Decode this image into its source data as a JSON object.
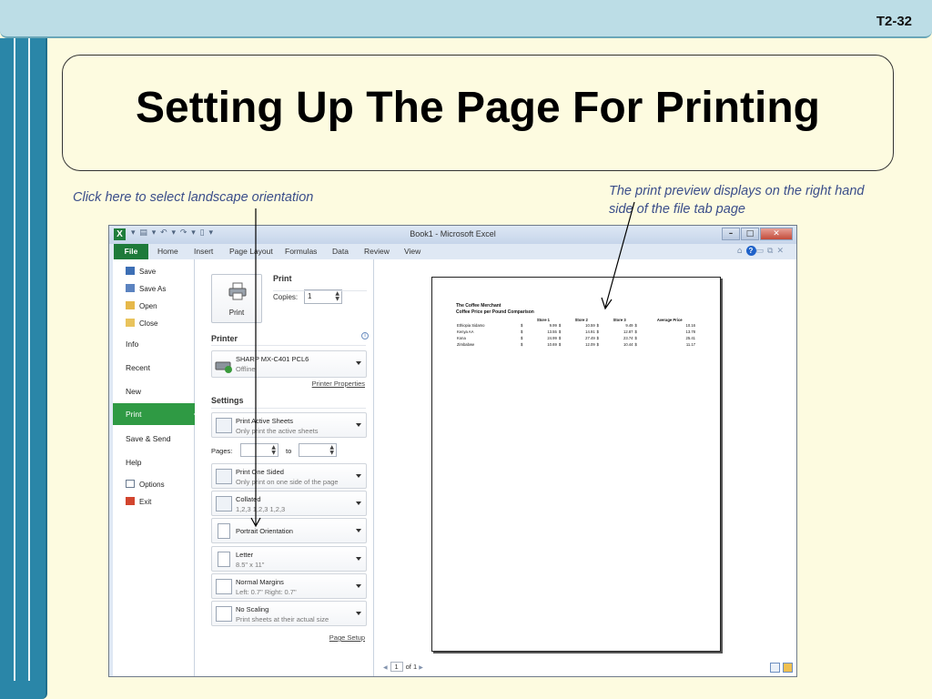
{
  "slide": {
    "number": "T2-32",
    "title": "Setting Up The Page For Printing",
    "annotation_left": "Click here to select landscape orientation",
    "annotation_right": "The print preview displays on the right hand side of the file tab page"
  },
  "window": {
    "title": "Book1 - Microsoft Excel",
    "app_icon": "X",
    "controls": [
      "–",
      "□",
      "✕"
    ]
  },
  "ribbon_tabs": [
    "File",
    "Home",
    "Insert",
    "Page Layout",
    "Formulas",
    "Data",
    "Review",
    "View"
  ],
  "nav": {
    "items": [
      {
        "label": "Save",
        "icon": "save-icon"
      },
      {
        "label": "Save As",
        "icon": "save-as-icon"
      },
      {
        "label": "Open",
        "icon": "open-folder-icon"
      },
      {
        "label": "Close",
        "icon": "close-folder-icon"
      },
      {
        "label": "Info"
      },
      {
        "label": "Recent"
      },
      {
        "label": "New"
      },
      {
        "label": "Print",
        "selected": true
      },
      {
        "label": "Save & Send"
      },
      {
        "label": "Help"
      },
      {
        "label": "Options",
        "icon": "options-icon"
      },
      {
        "label": "Exit",
        "icon": "exit-icon"
      }
    ]
  },
  "print": {
    "button_label": "Print",
    "heading": "Print",
    "copies_label": "Copies:",
    "copies_value": "1"
  },
  "printer": {
    "heading": "Printer",
    "info_icon": "i",
    "name": "SHARP MX-C401 PCL6",
    "status": "Offline",
    "properties_link": "Printer Properties"
  },
  "settings": {
    "heading": "Settings",
    "what": {
      "title": "Print Active Sheets",
      "subtitle": "Only print the active sheets"
    },
    "pages_label": "Pages:",
    "pages_to": "to",
    "sides": {
      "title": "Print One Sided",
      "subtitle": "Only print on one side of the page"
    },
    "collation": {
      "title": "Collated",
      "subtitle": "1,2,3    1,2,3    1,2,3"
    },
    "orientation": {
      "title": "Portrait Orientation"
    },
    "paper": {
      "title": "Letter",
      "subtitle": "8.5\" x 11\""
    },
    "margins": {
      "title": "Normal Margins",
      "subtitle": "Left:  0.7\"    Right:  0.7\""
    },
    "scaling": {
      "title": "No Scaling",
      "subtitle": "Print sheets at their actual size"
    },
    "page_setup_link": "Page Setup"
  },
  "preview": {
    "title_line1": "The Coffee Merchant",
    "title_line2": "Coffee Price per Pound Comparison",
    "columns": [
      "Store 1",
      "Store 2",
      "Store 3",
      "Average Price"
    ],
    "rows": [
      {
        "name": "Ethiopia Sidamo",
        "values": [
          "9.99",
          "10.59",
          "9.49",
          "10.16"
        ]
      },
      {
        "name": "Kenya AA",
        "values": [
          "13.55",
          "14.91",
          "12.87",
          "13.78"
        ]
      },
      {
        "name": "Kona",
        "values": [
          "24.99",
          "27.49",
          "23.74",
          "25.41"
        ]
      },
      {
        "name": "Zimbabwe",
        "values": [
          "10.69",
          "12.09",
          "10.44",
          "11.17"
        ]
      }
    ],
    "currency": "$",
    "pager": {
      "current": "1",
      "total_label": "of 1"
    }
  }
}
